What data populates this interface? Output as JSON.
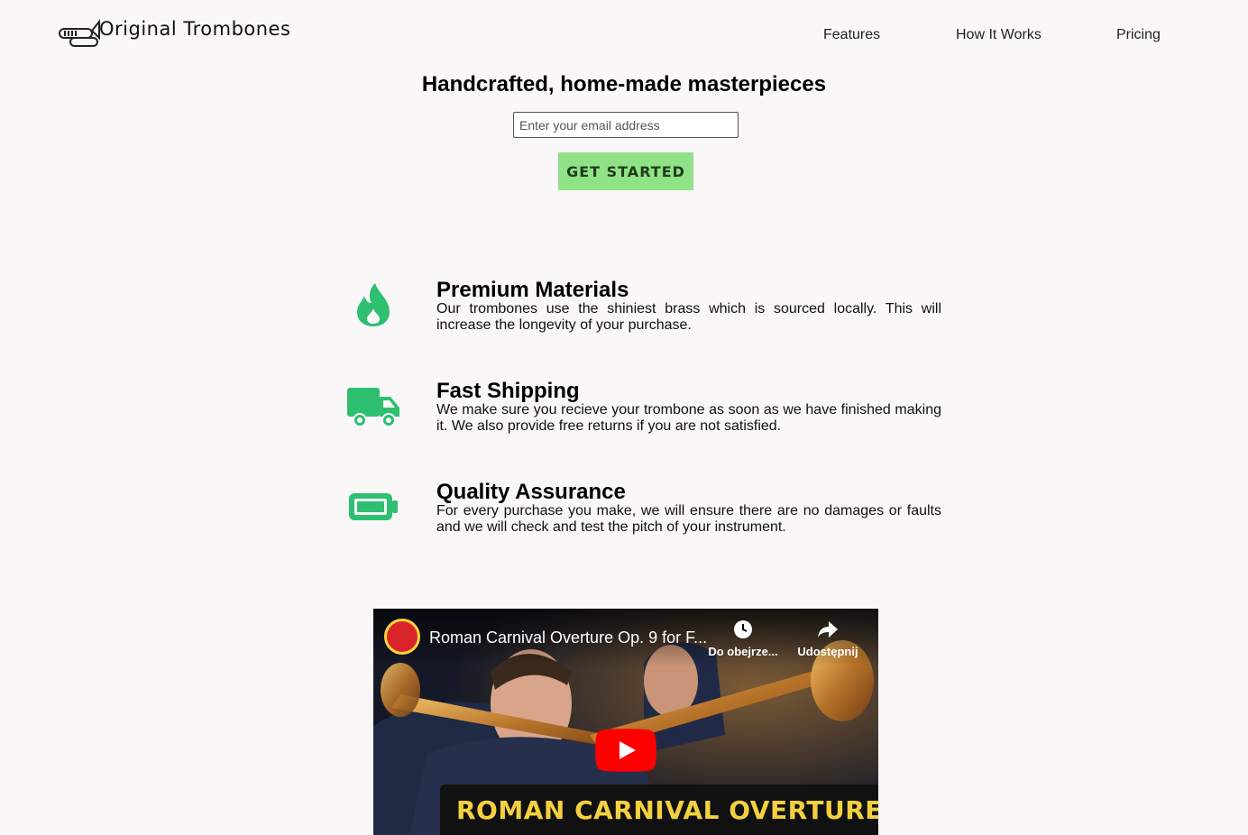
{
  "header": {
    "brand": "Original Trombones",
    "nav": [
      {
        "label": "Features"
      },
      {
        "label": "How It Works"
      },
      {
        "label": "Pricing"
      }
    ]
  },
  "hero": {
    "title": "Handcrafted, home-made masterpieces",
    "email_placeholder": "Enter your email address",
    "email_value": "",
    "cta_label": "GET STARTED"
  },
  "features": [
    {
      "icon": "fire-icon",
      "title": "Premium Materials",
      "text": "Our trombones use the shiniest brass which is sourced locally. This will increase the longevity of your purchase."
    },
    {
      "icon": "truck-icon",
      "title": "Fast Shipping",
      "text": "We make sure you recieve your trombone as soon as we have finished making it. We also provide free returns if you are not satisfied."
    },
    {
      "icon": "battery-icon",
      "title": "Quality Assurance",
      "text": "For every purchase you make, we will ensure there are no damages or faults and we will check and test the pitch of your instrument."
    }
  ],
  "video": {
    "title": "Roman Carnival Overture Op. 9 for F...",
    "watch_later": "Do obejrze...",
    "share": "Udostępnij",
    "banner": "ROMAN CARNIVAL OVERTURE"
  },
  "colors": {
    "accent_green": "#2fbf71",
    "cta_green": "#90e286",
    "youtube_red": "#ff0000"
  }
}
